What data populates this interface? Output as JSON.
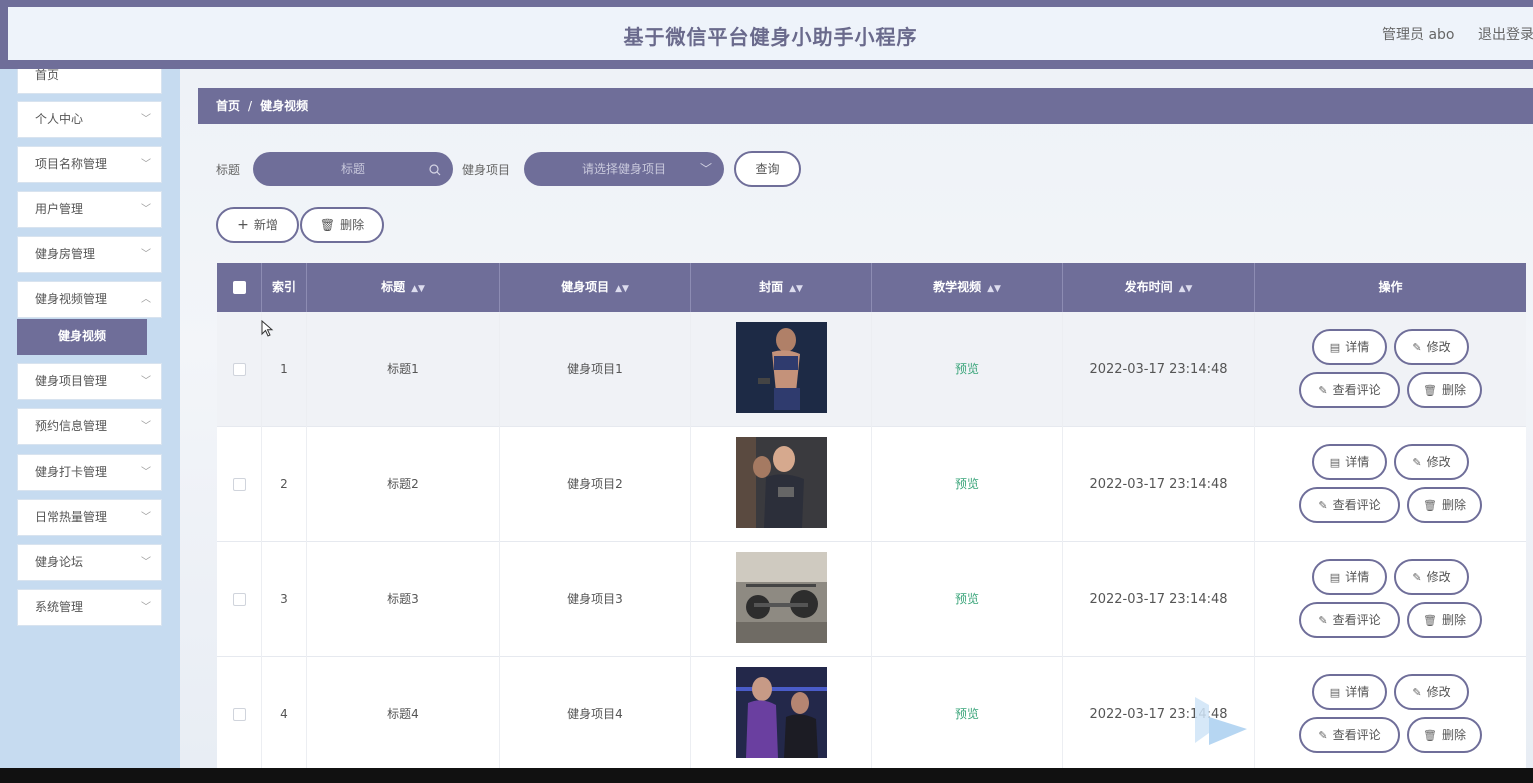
{
  "header": {
    "title": "基于微信平台健身小助手小程序",
    "admin": "管理员 abo",
    "logout": "退出登录"
  },
  "sidebar": {
    "items": [
      {
        "label": "首页"
      },
      {
        "label": "个人中心"
      },
      {
        "label": "项目名称管理"
      },
      {
        "label": "用户管理"
      },
      {
        "label": "健身房管理"
      },
      {
        "label": "健身视频管理"
      },
      {
        "label": "健身视频",
        "sub": true
      },
      {
        "label": "健身项目管理"
      },
      {
        "label": "预约信息管理"
      },
      {
        "label": "健身打卡管理"
      },
      {
        "label": "日常热量管理"
      },
      {
        "label": "健身论坛"
      },
      {
        "label": "系统管理"
      }
    ]
  },
  "breadcrumb": {
    "home": "首页",
    "separator": "/",
    "current": "健身视频"
  },
  "search": {
    "title_label": "标题",
    "title_placeholder": "标题",
    "project_label": "健身项目",
    "project_placeholder": "请选择健身项目",
    "query_button": "查询"
  },
  "actions": {
    "add": "新增",
    "delete": "删除"
  },
  "table": {
    "columns": [
      "索引",
      "标题",
      "健身项目",
      "封面",
      "教学视频",
      "发布时间",
      "操作"
    ],
    "rows": [
      {
        "index": "1",
        "title": "标题1",
        "project": "健身项目1",
        "video": "预览",
        "time": "2022-03-17 23:14:48"
      },
      {
        "index": "2",
        "title": "标题2",
        "project": "健身项目2",
        "video": "预览",
        "time": "2022-03-17 23:14:48"
      },
      {
        "index": "3",
        "title": "标题3",
        "project": "健身项目3",
        "video": "预览",
        "time": "2022-03-17 23:14:48"
      },
      {
        "index": "4",
        "title": "标题4",
        "project": "健身项目4",
        "video": "预览",
        "time": "2022-03-17 23:14:48"
      }
    ],
    "row_actions": {
      "detail": "详情",
      "edit": "修改",
      "comments": "查看评论",
      "delete": "删除"
    }
  },
  "colors": {
    "primary": "#6f6e99",
    "sidebar_bg": "#c6dbf0",
    "preview": "#3aa57a"
  }
}
